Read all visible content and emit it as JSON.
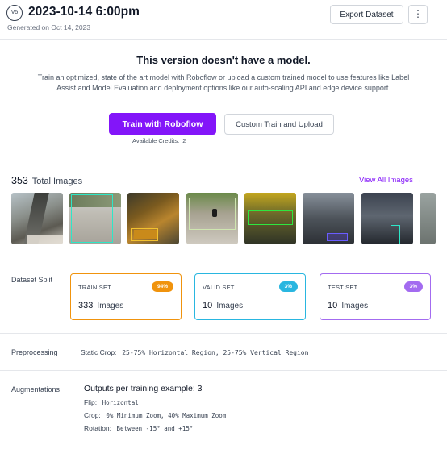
{
  "header": {
    "version_badge": "V5",
    "title": "2023-10-14 6:00pm",
    "generated": "Generated on Oct 14, 2023",
    "export_label": "Export Dataset",
    "more_icon": "more-vertical-icon"
  },
  "no_model": {
    "heading": "This version doesn't have a model.",
    "description": "Train an optimized, state of the art model with Roboflow or upload a custom trained model to use features like Label Assist and Model Evaluation and deployment options like our auto-scaling API and edge device support.",
    "train_button": "Train with Roboflow",
    "custom_button": "Custom Train and Upload",
    "credits_label": "Available Credits:",
    "credits_value": "2"
  },
  "images": {
    "count": "353",
    "label": "Total Images",
    "view_all": "View All Images",
    "view_all_icon": "arrow-right-icon"
  },
  "dataset_split": {
    "label": "Dataset Split",
    "train": {
      "label": "TRAIN SET",
      "percent": "94%",
      "count": "333",
      "unit": "Images",
      "color": "#f0930d"
    },
    "valid": {
      "label": "VALID SET",
      "percent": "3%",
      "count": "10",
      "unit": "Images",
      "color": "#29b6e0"
    },
    "test": {
      "label": "TEST SET",
      "percent": "3%",
      "count": "10",
      "unit": "Images",
      "color": "#a36bf0"
    }
  },
  "preprocessing": {
    "label": "Preprocessing",
    "key": "Static Crop:",
    "value": "25-75% Horizontal Region, 25-75% Vertical Region"
  },
  "augmentations": {
    "label": "Augmentations",
    "outputs": "Outputs per training example: 3",
    "items": [
      {
        "key": "Flip:",
        "value": "Horizontal"
      },
      {
        "key": "Crop:",
        "value": "0% Minimum Zoom, 40% Maximum Zoom"
      },
      {
        "key": "Rotation:",
        "value": "Between -15° and +15°"
      }
    ]
  },
  "colors": {
    "accent": "#8315f9"
  }
}
